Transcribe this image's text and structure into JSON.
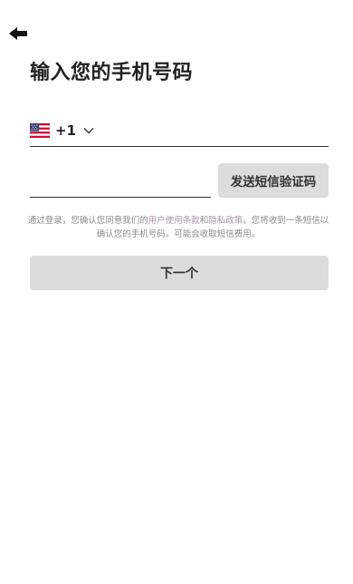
{
  "header": {
    "back_icon": "arrow-left-icon",
    "title": "输入您的手机号码"
  },
  "phone_form": {
    "country_flag": "us-flag-icon",
    "dial_code": "+1",
    "dropdown_icon": "chevron-down-icon",
    "phone_value": "",
    "phone_placeholder": "",
    "send_code_label": "发送短信验证码"
  },
  "terms": {
    "prefix": "通过登录，您确认您同意我们的",
    "terms_link": "用户使用条款",
    "and": "和",
    "privacy_link": "隐私政策",
    "suffix": "。您将收到一条短信以确认您的手机号码。可能会收取短信费用。"
  },
  "next_button": {
    "label": "下一个"
  },
  "colors": {
    "button_bg": "#dcdcdc",
    "text_primary": "#222222",
    "text_muted": "#8a8a8a",
    "link": "#a891a8"
  }
}
